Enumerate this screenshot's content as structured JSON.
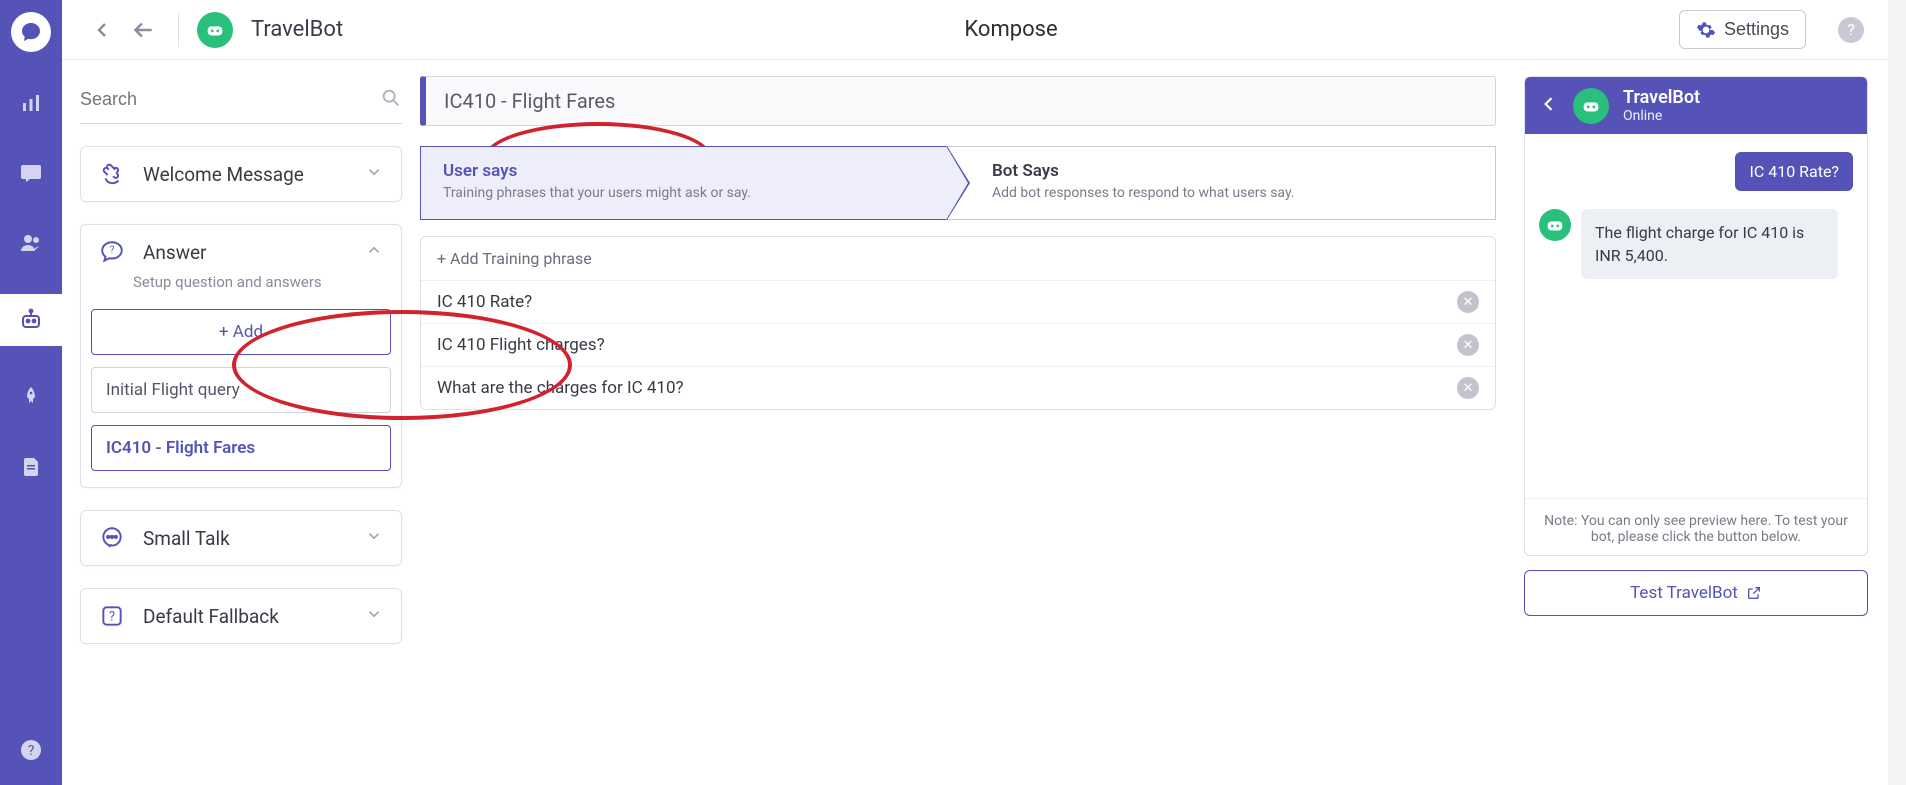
{
  "topbar": {
    "bot_name": "TravelBot",
    "app_title": "Kompose",
    "settings_label": "Settings"
  },
  "leftpanel": {
    "search_placeholder": "Search",
    "welcome_label": "Welcome Message",
    "answer": {
      "label": "Answer",
      "desc": "Setup question and answers",
      "add_label": "+ Add",
      "intents": [
        {
          "label": "Initial Flight query",
          "selected": false
        },
        {
          "label": "IC410 - Flight Fares",
          "selected": true
        }
      ]
    },
    "smalltalk_label": "Small Talk",
    "fallback_label": "Default Fallback"
  },
  "center": {
    "intent_title": "IC410 - Flight Fares",
    "user_tab": {
      "title": "User says",
      "subtitle": "Training phrases that your users might ask or say."
    },
    "bot_tab": {
      "title": "Bot Says",
      "subtitle": "Add bot responses to respond to what users say."
    },
    "add_phrase_label": "+ Add Training phrase",
    "phrases": [
      "IC 410 Rate?",
      "IC 410 Flight charges?",
      "What are the charges for IC 410?"
    ]
  },
  "preview": {
    "bot_name": "TravelBot",
    "status": "Online",
    "user_msg": "IC 410 Rate?",
    "bot_msg": "The flight charge for IC 410 is INR 5,400.",
    "note": "Note: You can only see preview here. To test your bot, please click the button below.",
    "test_label": "Test TravelBot"
  }
}
